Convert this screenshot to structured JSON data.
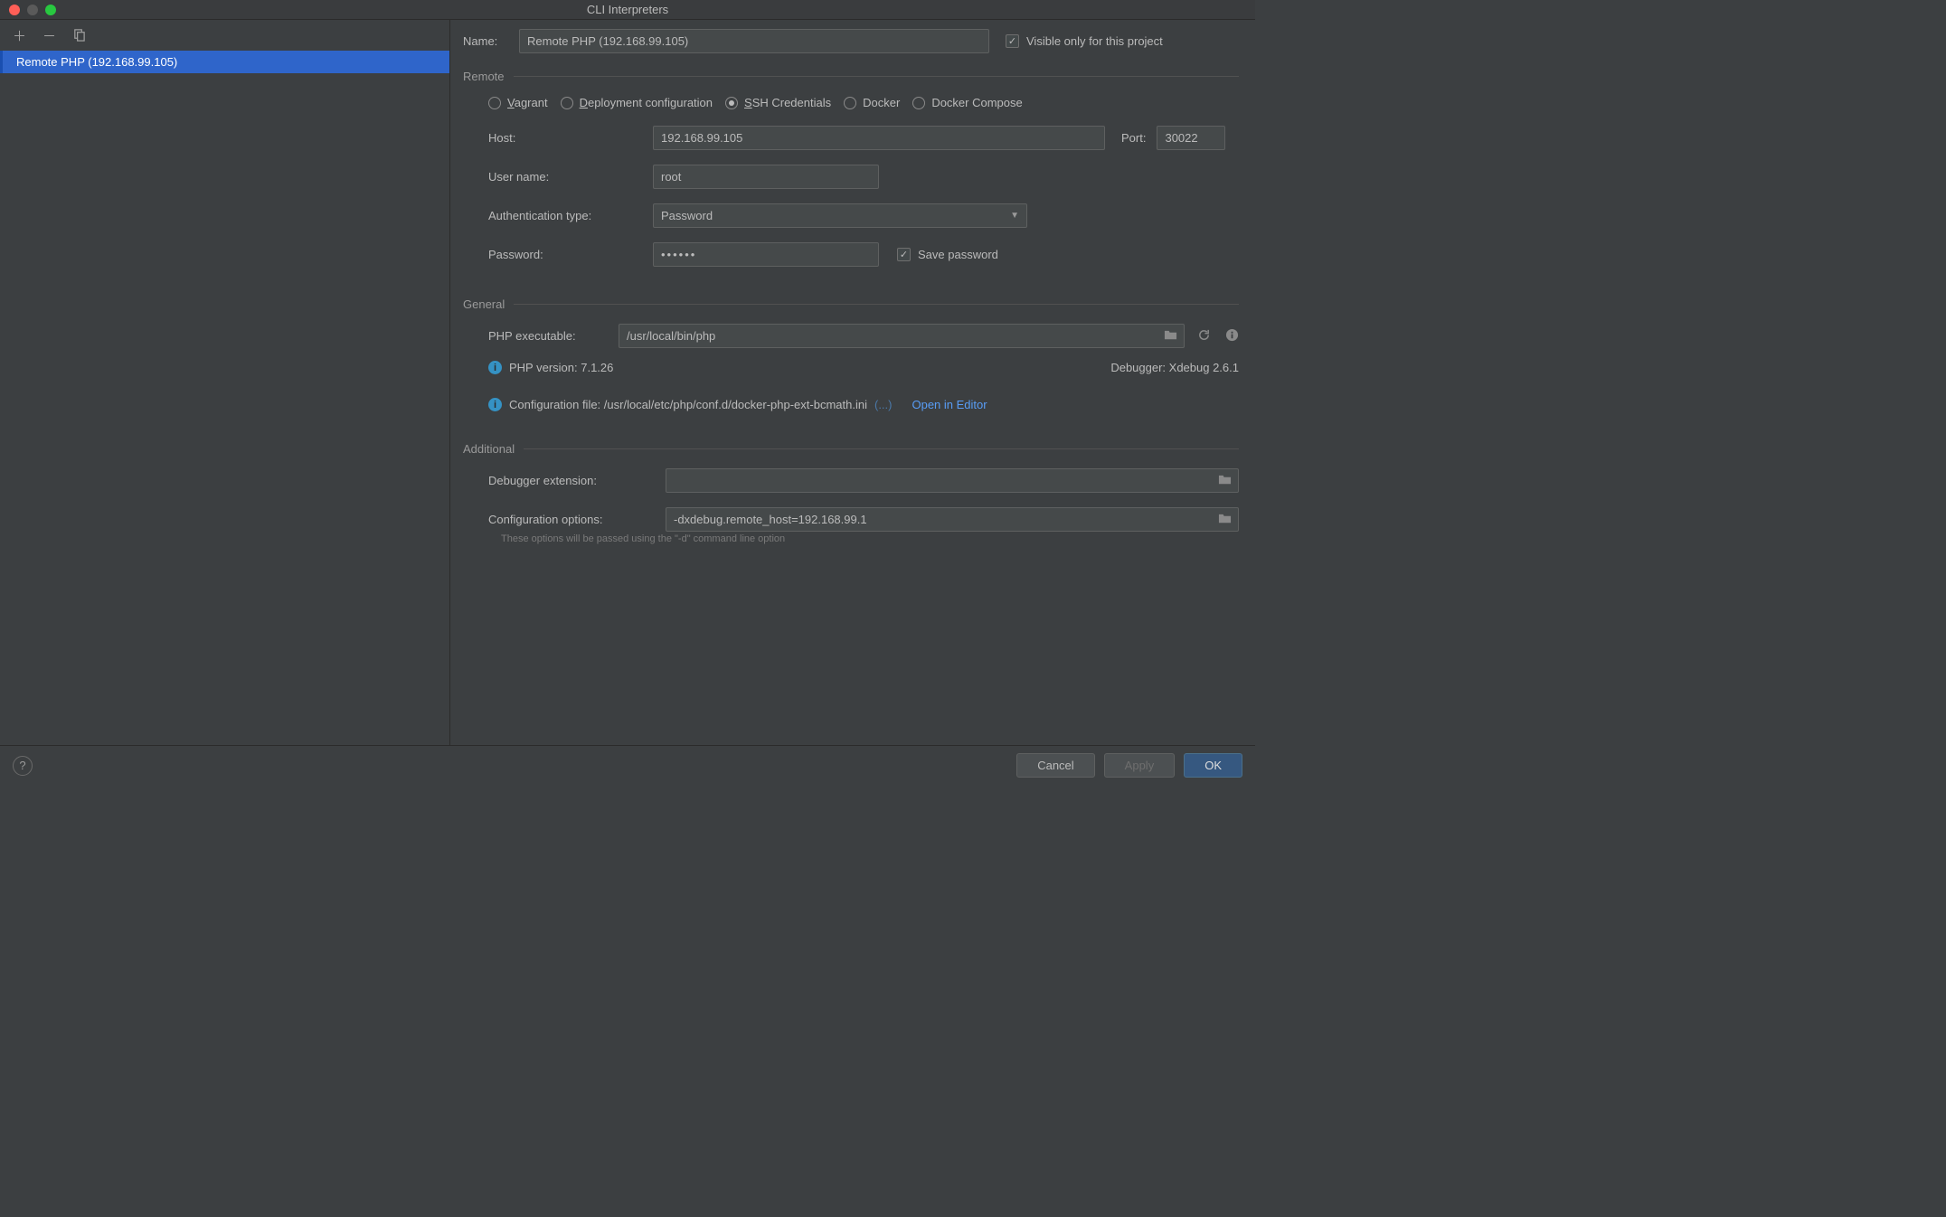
{
  "window": {
    "title": "CLI Interpreters"
  },
  "sidebar": {
    "items": [
      {
        "label": "Remote PHP (192.168.99.105)"
      }
    ]
  },
  "main": {
    "name_label": "Name:",
    "name_value": "Remote PHP (192.168.99.105)",
    "visible_only_label": "Visible only for this project",
    "sections": {
      "remote": "Remote",
      "general": "General",
      "additional": "Additional"
    },
    "remote": {
      "radios": {
        "vagrant": "Vagrant",
        "deployment": "Deployment configuration",
        "ssh": "SSH Credentials",
        "docker": "Docker",
        "docker_compose": "Docker Compose"
      },
      "host_label": "Host:",
      "host_value": "192.168.99.105",
      "port_label": "Port:",
      "port_value": "30022",
      "user_label": "User name:",
      "user_value": "root",
      "auth_label": "Authentication type:",
      "auth_value": "Password",
      "password_label": "Password:",
      "password_value": "••••••",
      "save_password_label": "Save password"
    },
    "general": {
      "exec_label": "PHP executable:",
      "exec_value": "/usr/local/bin/php",
      "php_version_label": "PHP version: 7.1.26",
      "debugger_label": "Debugger: Xdebug 2.6.1",
      "config_file_prefix": "Configuration file: ",
      "config_file_value": "/usr/local/etc/php/conf.d/docker-php-ext-bcmath.ini",
      "config_more": "(...)",
      "open_in_editor": "Open in Editor"
    },
    "additional": {
      "debugger_ext_label": "Debugger extension:",
      "debugger_ext_value": "",
      "config_opts_label": "Configuration options:",
      "config_opts_value": "-dxdebug.remote_host=192.168.99.1",
      "hint": "These options will be passed using the \"-d\" command line option"
    }
  },
  "footer": {
    "cancel": "Cancel",
    "apply": "Apply",
    "ok": "OK"
  }
}
